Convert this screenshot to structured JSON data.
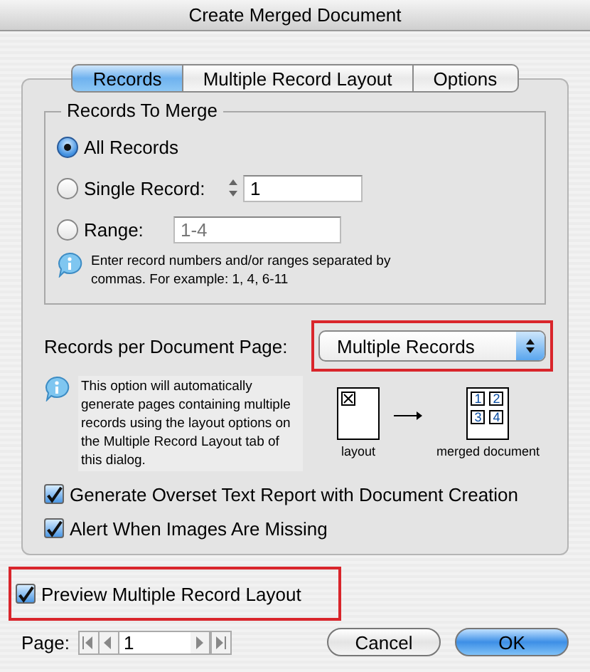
{
  "window": {
    "title": "Create Merged Document"
  },
  "tabs": [
    {
      "label": "Records",
      "selected": true
    },
    {
      "label": "Multiple Record Layout",
      "selected": false
    },
    {
      "label": "Options",
      "selected": false
    }
  ],
  "records_to_merge": {
    "title": "Records To Merge",
    "options": [
      {
        "label": "All Records",
        "selected": true,
        "kind": "plain"
      },
      {
        "label": "Single Record:",
        "selected": false,
        "kind": "stepper",
        "value": "1"
      },
      {
        "label": "Range:",
        "selected": false,
        "kind": "field",
        "value": "1-4"
      }
    ],
    "hint": "Enter record numbers and/or ranges separated by commas. For example: 1, 4, 6-11"
  },
  "records_per_page": {
    "label": "Records per Document Page:",
    "value": "Multiple Records",
    "highlighted": true
  },
  "info": {
    "text": "This option will automatically generate pages containing multiple records using the layout options on the Multiple Record Layout tab of this dialog.",
    "layout_caption": "layout",
    "merged_caption": "merged document",
    "cells": [
      "1",
      "2",
      "3",
      "4"
    ]
  },
  "checkboxes": [
    {
      "label": "Generate Overset Text Report with Document Creation",
      "checked": true
    },
    {
      "label": "Alert When Images Are Missing",
      "checked": true
    }
  ],
  "preview": {
    "label": "Preview Multiple Record Layout",
    "checked": true,
    "highlighted": true
  },
  "page": {
    "label": "Page:",
    "value": "1"
  },
  "buttons": [
    {
      "label": "Cancel",
      "kind": "secondary"
    },
    {
      "label": "OK",
      "kind": "default"
    }
  ]
}
